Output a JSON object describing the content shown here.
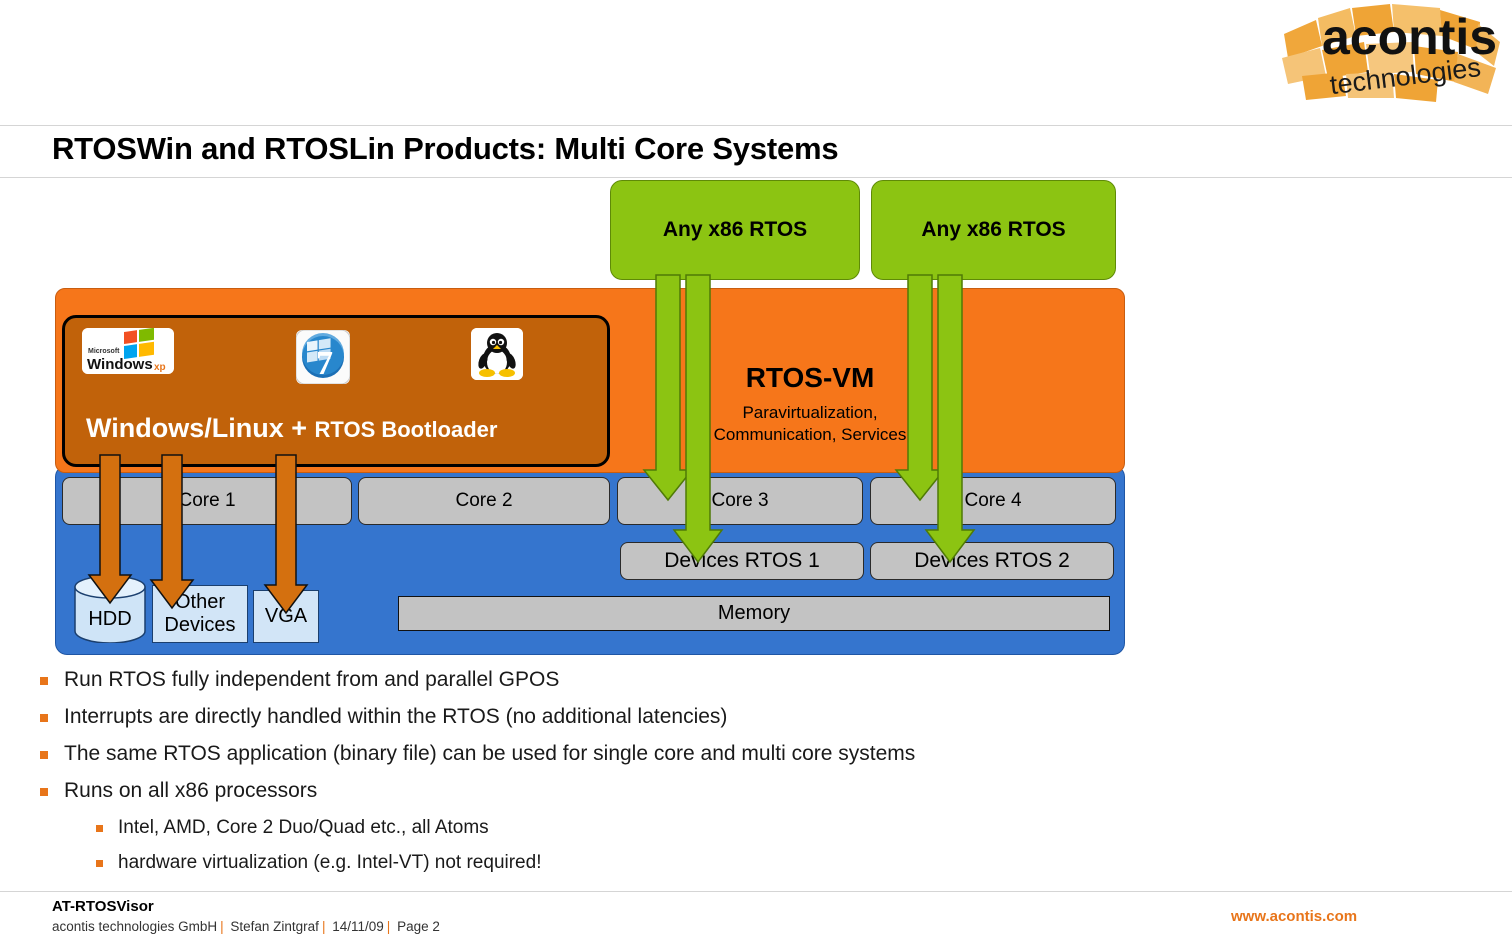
{
  "brand": {
    "logo_name": "acontis",
    "logo_sub": "technologies",
    "accent_orange": "#E8751A",
    "hypervisor_orange": "#F6761A",
    "gpos_orange": "#C1620A",
    "rtos_green": "#8CC412",
    "hardware_blue": "#3575CE",
    "box_gray": "#C3C3C3",
    "device_blue": "#D2E5F7"
  },
  "header": {
    "title": "RTOSWin and RTOSLin Products: Multi Core Systems"
  },
  "diagram": {
    "rtos_boxes": [
      {
        "label": "Any x86 RTOS"
      },
      {
        "label": "Any x86 RTOS"
      }
    ],
    "hypervisor": {
      "title": "RTOS-VM",
      "subtitle": "Paravirtualization,\nCommunication, Services"
    },
    "gpos": {
      "label_main": "Windows/Linux",
      "label_plus": " + ",
      "label_rest": "RTOS Bootloader",
      "os_logos": [
        {
          "name": "windows-xp-logo",
          "caption": "Windows",
          "caption_sub": "xp",
          "caption_pre": "Microsoft"
        },
        {
          "name": "windows-7-logo",
          "caption": "7"
        },
        {
          "name": "linux-tux-logo",
          "caption": ""
        }
      ]
    },
    "cores": [
      {
        "label": "Core 1"
      },
      {
        "label": "Core 2"
      },
      {
        "label": "Core 3"
      },
      {
        "label": "Core 4"
      }
    ],
    "rtos_devices": [
      {
        "label": "Devices RTOS 1"
      },
      {
        "label": "Devices RTOS 2"
      }
    ],
    "memory": {
      "label": "Memory"
    },
    "gpos_devices": [
      {
        "label": "HDD"
      },
      {
        "label": "Other\nDevices"
      },
      {
        "label": "VGA"
      }
    ]
  },
  "bullets": [
    {
      "level": 1,
      "text": "Run RTOS fully independent from and parallel GPOS"
    },
    {
      "level": 1,
      "text": "Interrupts are directly handled within the RTOS (no additional latencies)"
    },
    {
      "level": 1,
      "text": "The same RTOS application (binary file) can be used for single core and multi core systems"
    },
    {
      "level": 1,
      "text": "Runs on all x86 processors"
    },
    {
      "level": 2,
      "text": "Intel, AMD, Core 2 Duo/Quad etc., all Atoms"
    },
    {
      "level": 2,
      "text": "hardware virtualization (e.g. Intel-VT) not required!"
    }
  ],
  "footer": {
    "product": "AT-RTOSVisor",
    "company": "acontis technologies GmbH",
    "author": "Stefan Zintgraf",
    "date": "14/11/09",
    "page": "Page 2",
    "url": "www.acontis.com"
  }
}
